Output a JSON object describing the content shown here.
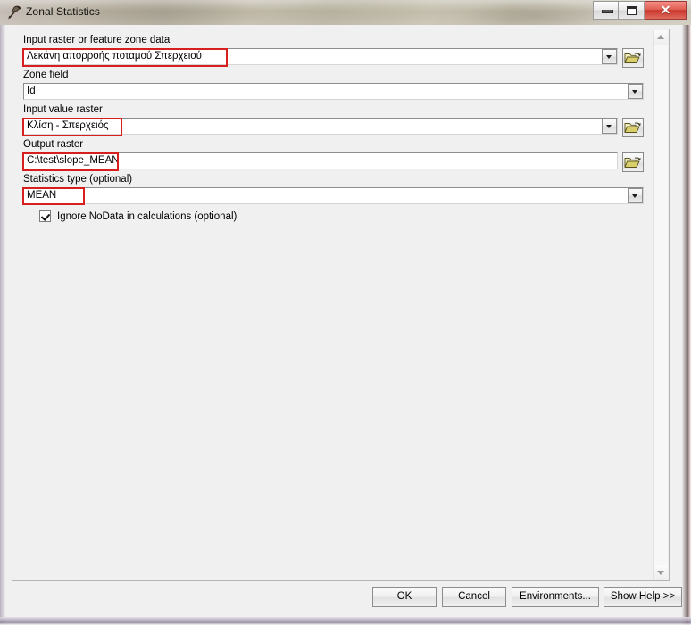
{
  "window": {
    "title": "Zonal Statistics",
    "icon": "hammer-tool-icon",
    "minimize_label": "Minimize",
    "maximize_label": "Maximize",
    "close_label": "✕"
  },
  "form": {
    "fields": [
      {
        "label": "Input raster or feature zone data",
        "value": "Λεκάνη απορροής ποταμού Σπερχειού",
        "has_dropdown": true,
        "has_browse": true,
        "highlighted": true
      },
      {
        "label": "Zone field",
        "value": "Id",
        "has_dropdown": true,
        "has_browse": false,
        "highlighted": false
      },
      {
        "label": "Input value raster",
        "value": "Κλίση - Σπερχειός",
        "has_dropdown": true,
        "has_browse": true,
        "highlighted": true
      },
      {
        "label": "Output raster",
        "value": "C:\\test\\slope_MEAN",
        "has_dropdown": false,
        "has_browse": true,
        "highlighted": true
      },
      {
        "label": "Statistics type (optional)",
        "value": "MEAN",
        "has_dropdown": true,
        "has_browse": false,
        "highlighted": true
      }
    ],
    "checkbox": {
      "label": "Ignore NoData in calculations (optional)",
      "checked": true
    }
  },
  "buttons": {
    "ok": "OK",
    "cancel": "Cancel",
    "environments": "Environments...",
    "show_help": "Show Help >>"
  },
  "colors": {
    "annotation": "#d81f1f",
    "dialog_bg": "#f0f0f0",
    "close_button": "#c9372c"
  }
}
